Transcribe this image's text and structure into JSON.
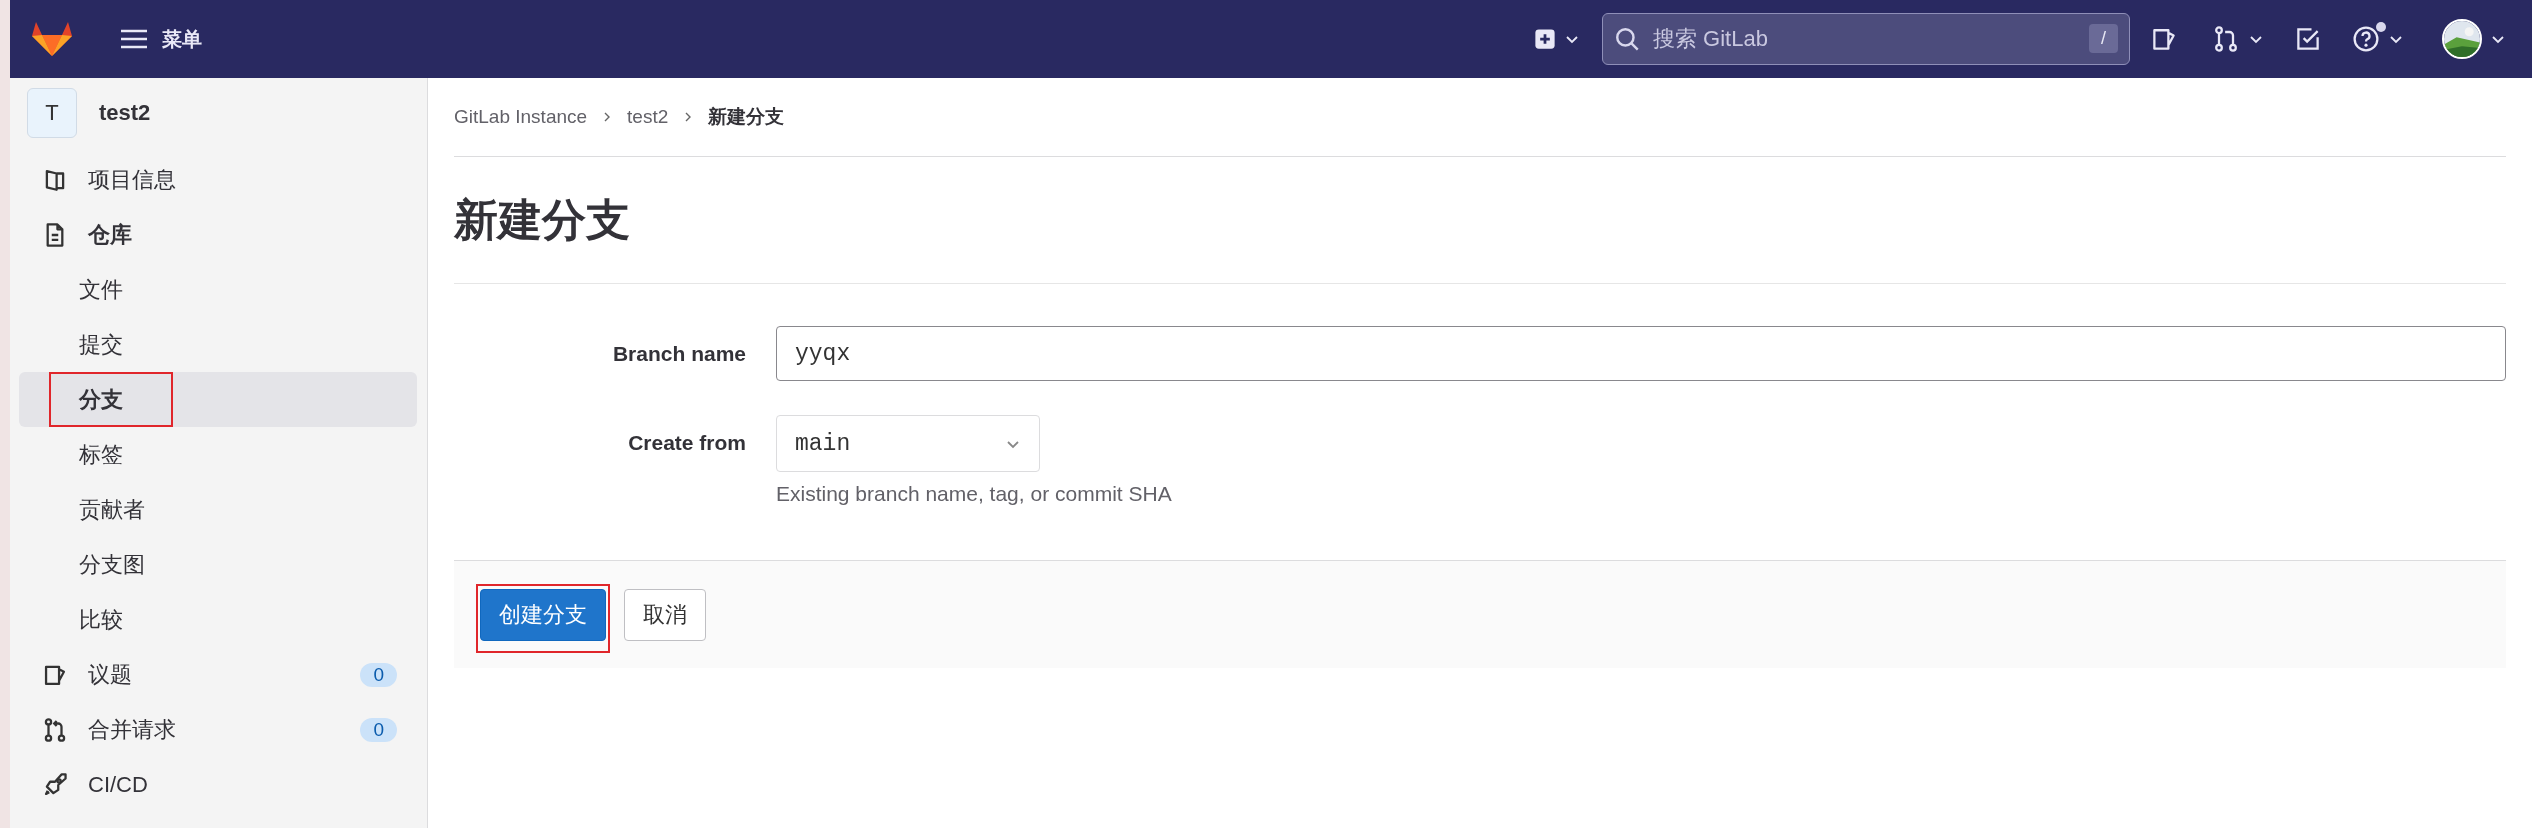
{
  "topbar": {
    "menu_label": "菜单",
    "search": {
      "placeholder": "搜索 GitLab",
      "shortcut": "/"
    },
    "help": {
      "notification": true
    }
  },
  "sidebar": {
    "project": {
      "avatar": "T",
      "name": "test2"
    },
    "items": [
      {
        "label": "项目信息",
        "kind": "info",
        "expanded": false
      },
      {
        "label": "仓库",
        "kind": "file",
        "expanded": true,
        "children": [
          {
            "label": "文件",
            "selected": false,
            "annotated": false
          },
          {
            "label": "提交",
            "selected": false,
            "annotated": false
          },
          {
            "label": "分支",
            "selected": true,
            "annotated": true
          },
          {
            "label": "标签",
            "selected": false,
            "annotated": false
          },
          {
            "label": "贡献者",
            "selected": false,
            "annotated": false
          },
          {
            "label": "分支图",
            "selected": false,
            "annotated": false
          },
          {
            "label": "比较",
            "selected": false,
            "annotated": false
          }
        ]
      },
      {
        "label": "议题",
        "kind": "issue",
        "expanded": false,
        "count": "0"
      },
      {
        "label": "合并请求",
        "kind": "merge",
        "expanded": false,
        "count": "0"
      },
      {
        "label": "CI/CD",
        "kind": "rocket",
        "expanded": false
      }
    ]
  },
  "main": {
    "breadcrumbs": [
      {
        "label": "GitLab Instance",
        "current": false
      },
      {
        "label": "test2",
        "current": false
      },
      {
        "label": "新建分支",
        "current": true
      }
    ],
    "title": "新建分支",
    "fields": [
      {
        "kind": "text",
        "label": "Branch name",
        "value": "yyqx"
      },
      {
        "kind": "select",
        "label": "Create from",
        "value": "main",
        "help": "Existing branch name, tag, or commit SHA"
      }
    ],
    "buttons": [
      {
        "label": "创建分支",
        "kind": "primary",
        "annotated": true
      },
      {
        "label": "取消",
        "kind": "default",
        "annotated": false
      }
    ]
  }
}
